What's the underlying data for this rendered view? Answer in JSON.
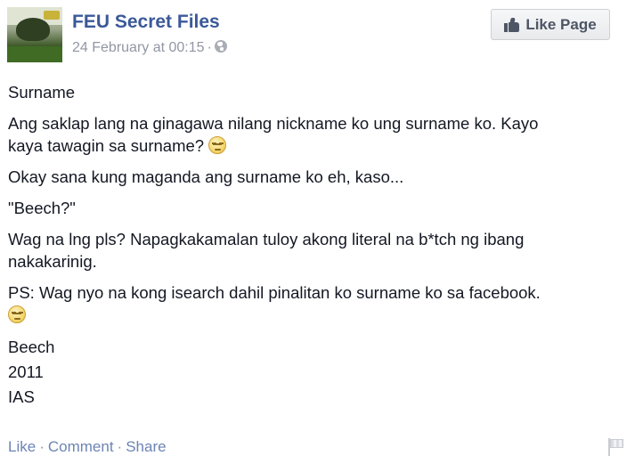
{
  "header": {
    "page_name": "FEU Secret Files",
    "timestamp": "24 February at 00:15",
    "separator": "·",
    "privacy_icon": "globe-icon",
    "like_button_label": "Like Page",
    "like_button_icon": "thumb-up-icon"
  },
  "post": {
    "title": "Surname",
    "p1_line1": "Ang saklap lang na ginagawa nilang nickname ko ung surname ko. Kayo",
    "p1_line2": "kaya tawagin sa surname? ",
    "p2": "Okay sana kung maganda ang surname ko eh, kaso...",
    "p3": "\"Beech?\"",
    "p4_line1": "Wag na lng pls? Napagkakamalan tuloy akong literal na b*tch ng ibang",
    "p4_line2": "nakakarinig.",
    "p5_line1": "PS: Wag nyo na kong isearch dahil pinalitan ko surname ko sa facebook.",
    "emoji_icon": "unamused-face-emoji",
    "signature": {
      "name": "Beech",
      "year": "2011",
      "dept": "IAS"
    }
  },
  "actions": {
    "like": "Like",
    "comment": "Comment",
    "share": "Share",
    "dot": "·",
    "flag_icon": "flag-icon"
  },
  "colors": {
    "link": "#3b5998",
    "action_link": "#6d84b4",
    "meta": "#9197a3",
    "text": "#141823"
  }
}
